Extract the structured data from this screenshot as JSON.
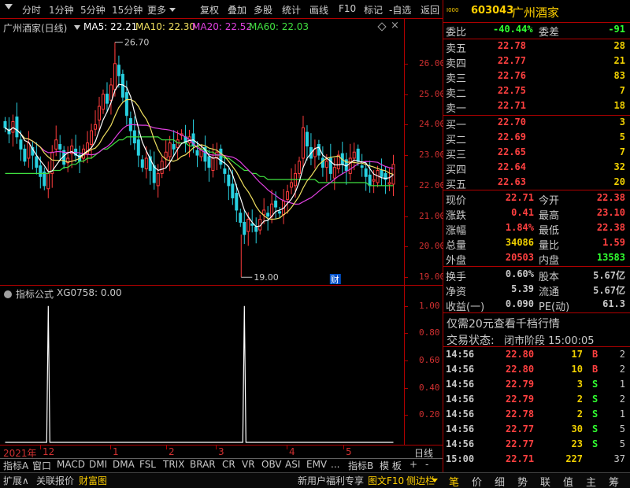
{
  "toolbar": {
    "periods": [
      "分时",
      "1分钟",
      "5分钟",
      "15分钟",
      "更多"
    ],
    "buttons": [
      "复权",
      "叠加",
      "多股",
      "统计",
      "画线",
      "F10",
      "标记",
      "-自选",
      "返回"
    ]
  },
  "chart_header": {
    "name": "广州酒家(日线)",
    "ma5": "MA5: 22.21",
    "ma10": "MA10: 22.30",
    "ma20": "MA20: 22.52",
    "ma60": "MA60: 22.03",
    "high_label": "26.70",
    "low_label": "19.00",
    "cai_badge": "财"
  },
  "indicator_header": {
    "title": "指标公式",
    "formula": "XG0758: 0.00"
  },
  "colors": {
    "up": "#ff3c3c",
    "down": "#28d0e0",
    "ma5": "#ffffff",
    "ma10": "#f0e060",
    "ma20": "#e040e0",
    "ma60": "#40e040",
    "grid": "#b00000"
  },
  "chart_data": [
    {
      "type": "candlestick",
      "title": "广州酒家(日线)",
      "ylim": [
        18.8,
        27.0
      ],
      "y_ticks": [
        19.0,
        20.0,
        21.0,
        22.0,
        23.0,
        24.0,
        25.0,
        26.0
      ],
      "x_labels": [
        "2021年",
        "12",
        "1",
        "2",
        "3",
        "4",
        "5"
      ],
      "high_marker": 26.7,
      "low_marker": 19.0,
      "close": [
        23.9,
        23.7,
        24.1,
        23.6,
        23.2,
        22.8,
        23.4,
        23.0,
        22.6,
        22.3,
        22.0,
        22.4,
        23.1,
        23.5,
        23.2,
        22.7,
        22.9,
        23.3,
        23.0,
        22.8,
        23.2,
        23.4,
        23.8,
        24.0,
        24.6,
        25.0,
        24.7,
        25.3,
        26.0,
        25.6,
        24.9,
        24.3,
        23.8,
        23.4,
        23.0,
        22.6,
        22.9,
        22.5,
        22.1,
        22.4,
        22.8,
        23.1,
        23.4,
        23.2,
        23.5,
        23.7,
        23.4,
        23.6,
        23.3,
        23.0,
        23.2,
        22.8,
        22.6,
        22.9,
        23.1,
        22.7,
        22.4,
        22.0,
        21.6,
        21.2,
        20.8,
        20.4,
        20.9,
        20.7,
        20.5,
        20.9,
        21.2,
        21.0,
        21.4,
        21.3,
        21.1,
        21.5,
        21.8,
        22.1,
        22.4,
        22.8,
        23.9,
        23.3,
        22.9,
        23.2,
        23.0,
        22.6,
        22.8,
        22.4,
        22.6,
        23.0,
        22.7,
        22.5,
        22.9,
        23.1,
        22.8,
        22.6,
        22.3,
        22.0,
        22.2,
        22.5,
        22.3,
        22.2,
        22.1,
        22.7
      ],
      "ma60": [
        22.4,
        22.4,
        22.4,
        22.4,
        22.4,
        22.4,
        22.4,
        22.4,
        22.4,
        22.4,
        22.4,
        22.4,
        22.5,
        22.5,
        22.5,
        22.6,
        22.6,
        22.7,
        22.7,
        22.8,
        22.8,
        22.9,
        22.9,
        23.0,
        23.1,
        23.2,
        23.2,
        23.3,
        23.4,
        23.5,
        23.5,
        23.6,
        23.6,
        23.6,
        23.6,
        23.6,
        23.6,
        23.6,
        23.6,
        23.6,
        23.5,
        23.5,
        23.5,
        23.5,
        23.4,
        23.4,
        23.4,
        23.3,
        23.3,
        23.3,
        23.2,
        23.2,
        23.1,
        23.1,
        23.0,
        23.0,
        22.9,
        22.9,
        22.8,
        22.7,
        22.6,
        22.5,
        22.5,
        22.4,
        22.4,
        22.3,
        22.3,
        22.2,
        22.2,
        22.2,
        22.2,
        22.2,
        22.2,
        22.2,
        22.2,
        22.2,
        22.2,
        22.2,
        22.2,
        22.2,
        22.1,
        22.1,
        22.1,
        22.1,
        22.1,
        22.1,
        22.1,
        22.1,
        22.1,
        22.1,
        22.1,
        22.1,
        22.1,
        22.0,
        22.0,
        22.0,
        22.0,
        22.0,
        22.0,
        22.0
      ]
    },
    {
      "type": "line",
      "series_name": "XG0758",
      "ylim": [
        0,
        1.05
      ],
      "y_ticks": [
        0.2,
        0.4,
        0.6,
        0.8,
        1.0
      ],
      "spikes": [
        {
          "index": 11,
          "value": 1.0
        },
        {
          "index": 61,
          "value": 1.0
        }
      ]
    }
  ],
  "quote": {
    "code": "603043",
    "name": "广州酒家",
    "weibi": {
      "label": "委比",
      "value": "-40.44%",
      "label2": "委差",
      "value2": "-91"
    },
    "asks": [
      {
        "label": "卖五",
        "price": "22.78",
        "vol": "28"
      },
      {
        "label": "卖四",
        "price": "22.77",
        "vol": "21"
      },
      {
        "label": "卖三",
        "price": "22.76",
        "vol": "83"
      },
      {
        "label": "卖二",
        "price": "22.75",
        "vol": "7"
      },
      {
        "label": "卖一",
        "price": "22.71",
        "vol": "18"
      }
    ],
    "bids": [
      {
        "label": "买一",
        "price": "22.70",
        "vol": "3"
      },
      {
        "label": "买二",
        "price": "22.69",
        "vol": "5"
      },
      {
        "label": "买三",
        "price": "22.65",
        "vol": "7"
      },
      {
        "label": "买四",
        "price": "22.64",
        "vol": "32"
      },
      {
        "label": "买五",
        "price": "22.63",
        "vol": "20"
      }
    ],
    "stats1": [
      {
        "l1": "现价",
        "v1": "22.71",
        "l2": "今开",
        "v2": "22.38"
      },
      {
        "l1": "涨跌",
        "v1": "0.41",
        "l2": "最高",
        "v2": "23.10"
      },
      {
        "l1": "涨幅",
        "v1": "1.84%",
        "l2": "最低",
        "v2": "22.38"
      },
      {
        "l1": "总量",
        "v1": "34086",
        "l2": "量比",
        "v2": "1.59"
      },
      {
        "l1": "外盘",
        "v1": "20503",
        "l2": "内盘",
        "v2": "13583"
      }
    ],
    "stats2": [
      {
        "l1": "换手",
        "v1": "0.60%",
        "l2": "股本",
        "v2": "5.67亿"
      },
      {
        "l1": "净资",
        "v1": "5.39",
        "l2": "流通",
        "v2": "5.67亿"
      },
      {
        "l1": "收益(一)",
        "v1": "0.090",
        "l2": "PE(动)",
        "v2": "61.3"
      }
    ],
    "promo": "仅需20元查看千档行情",
    "status_label": "交易状态:",
    "status_value": "闭市阶段 15:00:05",
    "ticks": [
      {
        "time": "14:56",
        "price": "22.80",
        "vol": "17",
        "dir": "B",
        "n": "2"
      },
      {
        "time": "14:56",
        "price": "22.80",
        "vol": "10",
        "dir": "B",
        "n": "2"
      },
      {
        "time": "14:56",
        "price": "22.79",
        "vol": "3",
        "dir": "S",
        "n": "1"
      },
      {
        "time": "14:56",
        "price": "22.79",
        "vol": "2",
        "dir": "S",
        "n": "2"
      },
      {
        "time": "14:56",
        "price": "22.78",
        "vol": "2",
        "dir": "S",
        "n": "1"
      },
      {
        "time": "14:56",
        "price": "22.77",
        "vol": "30",
        "dir": "S",
        "n": "5"
      },
      {
        "time": "14:56",
        "price": "22.77",
        "vol": "23",
        "dir": "S",
        "n": "5"
      },
      {
        "time": "15:00",
        "price": "22.71",
        "vol": "227",
        "dir": "",
        "n": "37"
      }
    ]
  },
  "bottom_tabs": {
    "indicators": [
      "指标A",
      "窗口",
      "MACD",
      "DMI",
      "DMA",
      "FSL",
      "TRIX",
      "BRAR",
      "CR",
      "VR",
      "OBV",
      "ASI",
      "EMV",
      "...",
      "指标B",
      "模 板",
      "+",
      "-"
    ],
    "day_line": "日线",
    "status": [
      "扩展∧",
      "关联报价",
      "财富图"
    ],
    "promo": "新用户福利专享",
    "right_links": [
      "图文F10",
      "侧边栏"
    ],
    "side_tabs": [
      "笔",
      "价",
      "细",
      "势",
      "联",
      "值",
      "主",
      "筹"
    ]
  }
}
